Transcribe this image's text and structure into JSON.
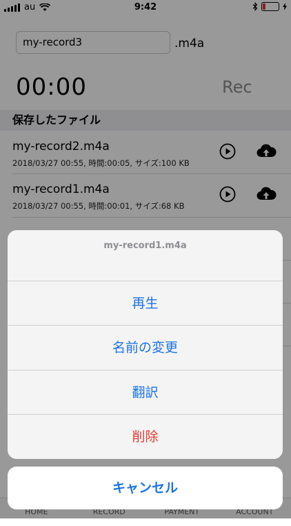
{
  "status_bar": {
    "carrier": "au",
    "time": "9:42",
    "battery_level": 0.2,
    "battery_color": "#e53935"
  },
  "recorder": {
    "filename_value": "my-record3",
    "extension": ".m4a",
    "timer": "00:00",
    "rec_label": "Rec"
  },
  "saved_files": {
    "header": "保存したファイル",
    "items": [
      {
        "name": "my-record2.m4a",
        "meta": "2018/03/27 00:55, 時間:00:05, サイズ:100 KB",
        "play_icon": "play-circle-icon",
        "upload_icon": "cloud-upload-icon"
      },
      {
        "name": "my-record1.m4a",
        "meta": "2018/03/27 00:55, 時間:00:01, サイズ:68 KB",
        "play_icon": "play-circle-icon",
        "upload_icon": "cloud-upload-icon"
      }
    ]
  },
  "tab_bar": {
    "items": [
      "HOME",
      "RECORD",
      "PAYMENT",
      "ACCOUNT"
    ]
  },
  "action_sheet": {
    "title": "my-record1.m4a",
    "actions": [
      "再生",
      "名前の変更",
      "翻訳",
      "削除"
    ],
    "cancel": "キャンセル",
    "accent_color": "#1a73e8",
    "destructive_color": "#e53935"
  }
}
